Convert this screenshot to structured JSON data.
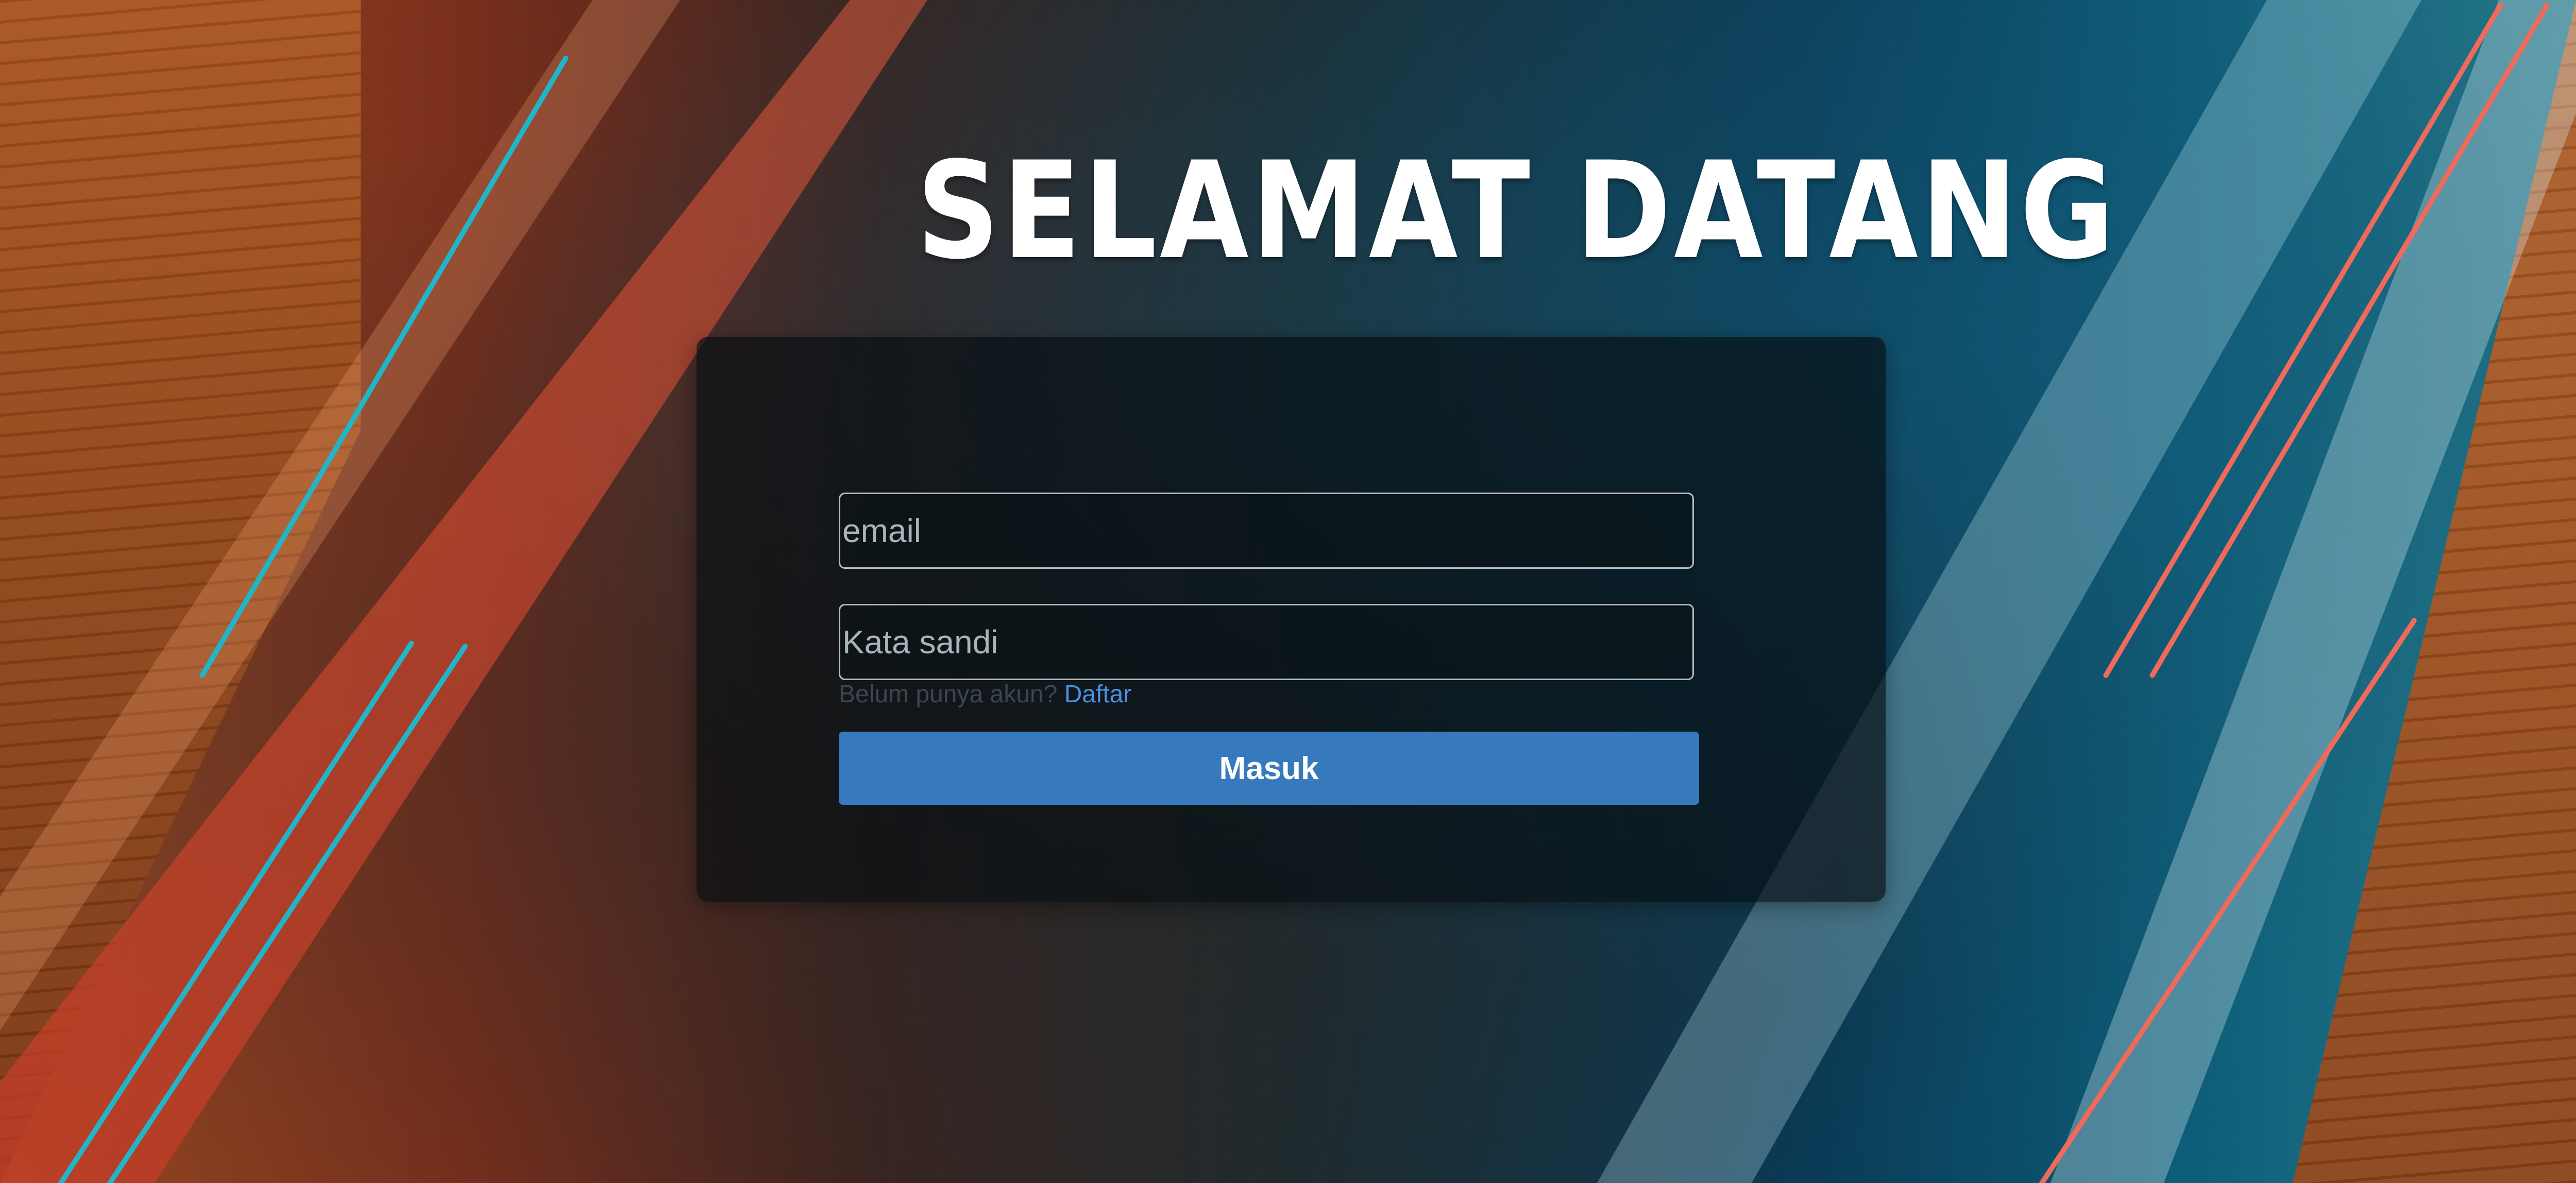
{
  "page": {
    "title": "SELAMAT DATANG"
  },
  "login_form": {
    "email_placeholder": "email",
    "password_placeholder": "Kata sandi",
    "register_prompt": "Belum punya akun?",
    "register_link": "Daftar",
    "submit_label": "Masuk"
  },
  "colors": {
    "button": "#3779bd",
    "link": "#4a90e2",
    "stripe_cyan": "#21b5c9",
    "stripe_coral": "#f06a5c"
  }
}
